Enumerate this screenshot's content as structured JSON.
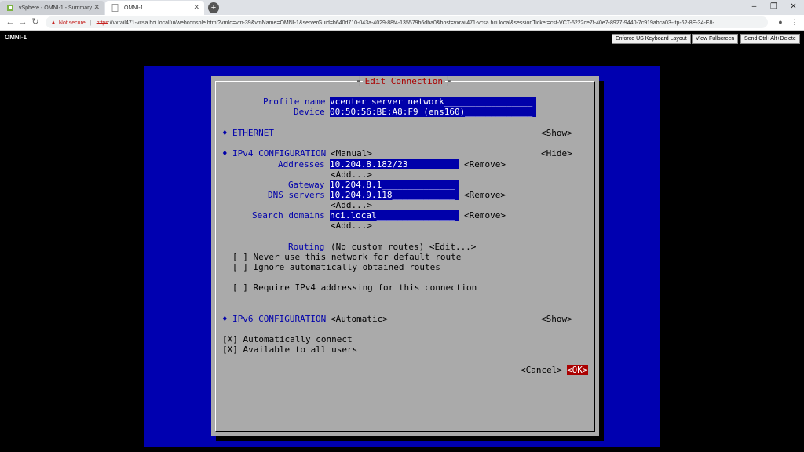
{
  "browser": {
    "tabs": [
      {
        "title": "vSphere - OMNI-1 - Summary",
        "active": false
      },
      {
        "title": "OMNI-1",
        "active": true
      }
    ],
    "window_controls": [
      "–",
      "❐",
      "✕"
    ],
    "address": {
      "warning": "Not secure",
      "separator": "|",
      "scheme": "https",
      "rest": "://vxrail471-vcsa.hci.local/ui/webconsole.html?vmId=vm-39&vmName=OMNI-1&serverGuid=b640d710-043a-4029-88f4-135579b6dba0&host=vxrail471-vcsa.hci.local&sessionTicket=cst-VCT-5222ce7f-40e7-8927-9440-7c919abca03--tp-62-8E-34-E8-..."
    }
  },
  "console": {
    "vm_name": "OMNI-1",
    "buttons": {
      "keyboard": "Enforce US Keyboard Layout",
      "fullscreen": "View Fullscreen",
      "cad": "Send Ctrl+Alt+Delete"
    }
  },
  "dialog": {
    "title": "Edit Connection",
    "profile_label": "Profile name",
    "profile_value": "vcenter server network_________________",
    "device_label": "Device",
    "device_value": "00:50:56:BE:A8:F9 (ens160)_____________",
    "ethernet": {
      "marker": "♦",
      "label": "ETHERNET",
      "toggle": "<Show>"
    },
    "ipv4": {
      "marker": "♦",
      "label": "IPv4 CONFIGURATION",
      "mode": "<Manual>",
      "toggle": "<Hide>",
      "addresses_label": "Addresses",
      "address_value": "10.204.8.182/23_________",
      "remove": "<Remove>",
      "add": "<Add...>",
      "gateway_label": "Gateway",
      "gateway_value": "10.204.8.1______________",
      "dns_label": "DNS servers",
      "dns_value": "10.204.9.118____________",
      "search_label": "Search domains",
      "search_value": "hci.local_______________",
      "routing_label": "Routing",
      "routing_value": "(No custom routes) <Edit...>",
      "never_default": "[ ] Never use this network for default route",
      "ignore_routes": "[ ] Ignore automatically obtained routes",
      "require_ipv4": "[ ] Require IPv4 addressing for this connection"
    },
    "ipv6": {
      "marker": "♦",
      "label": "IPv6 CONFIGURATION",
      "mode": "<Automatic>",
      "toggle": "<Show>"
    },
    "auto_connect": "[X] Automatically connect",
    "all_users": "[X] Available to all users",
    "cancel": "<Cancel>",
    "ok": "<OK>"
  }
}
